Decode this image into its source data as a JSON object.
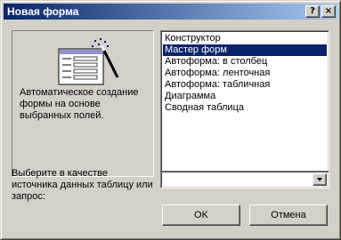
{
  "window": {
    "title": "Новая форма"
  },
  "titlebar": {
    "help_label": "?",
    "close_label": "×"
  },
  "preview": {
    "icon": "form-wizard-icon",
    "description": "Автоматическое создание формы на основе выбранных полей."
  },
  "form_types": {
    "items": [
      "Конструктор",
      "Мастер форм",
      "Автоформа: в столбец",
      "Автоформа: ленточная",
      "Автоформа: табличная",
      "Диаграмма",
      "Сводная таблица"
    ],
    "selected_index": 1
  },
  "source": {
    "label": "Выберите в качестве источника данных таблицу или запрос:",
    "value": ""
  },
  "buttons": {
    "ok": "OK",
    "cancel": "Отмена"
  },
  "colors": {
    "titlebar_start": "#0a246a",
    "titlebar_end": "#a6caf0",
    "selection": "#0a246a",
    "face": "#d4d0c8"
  }
}
